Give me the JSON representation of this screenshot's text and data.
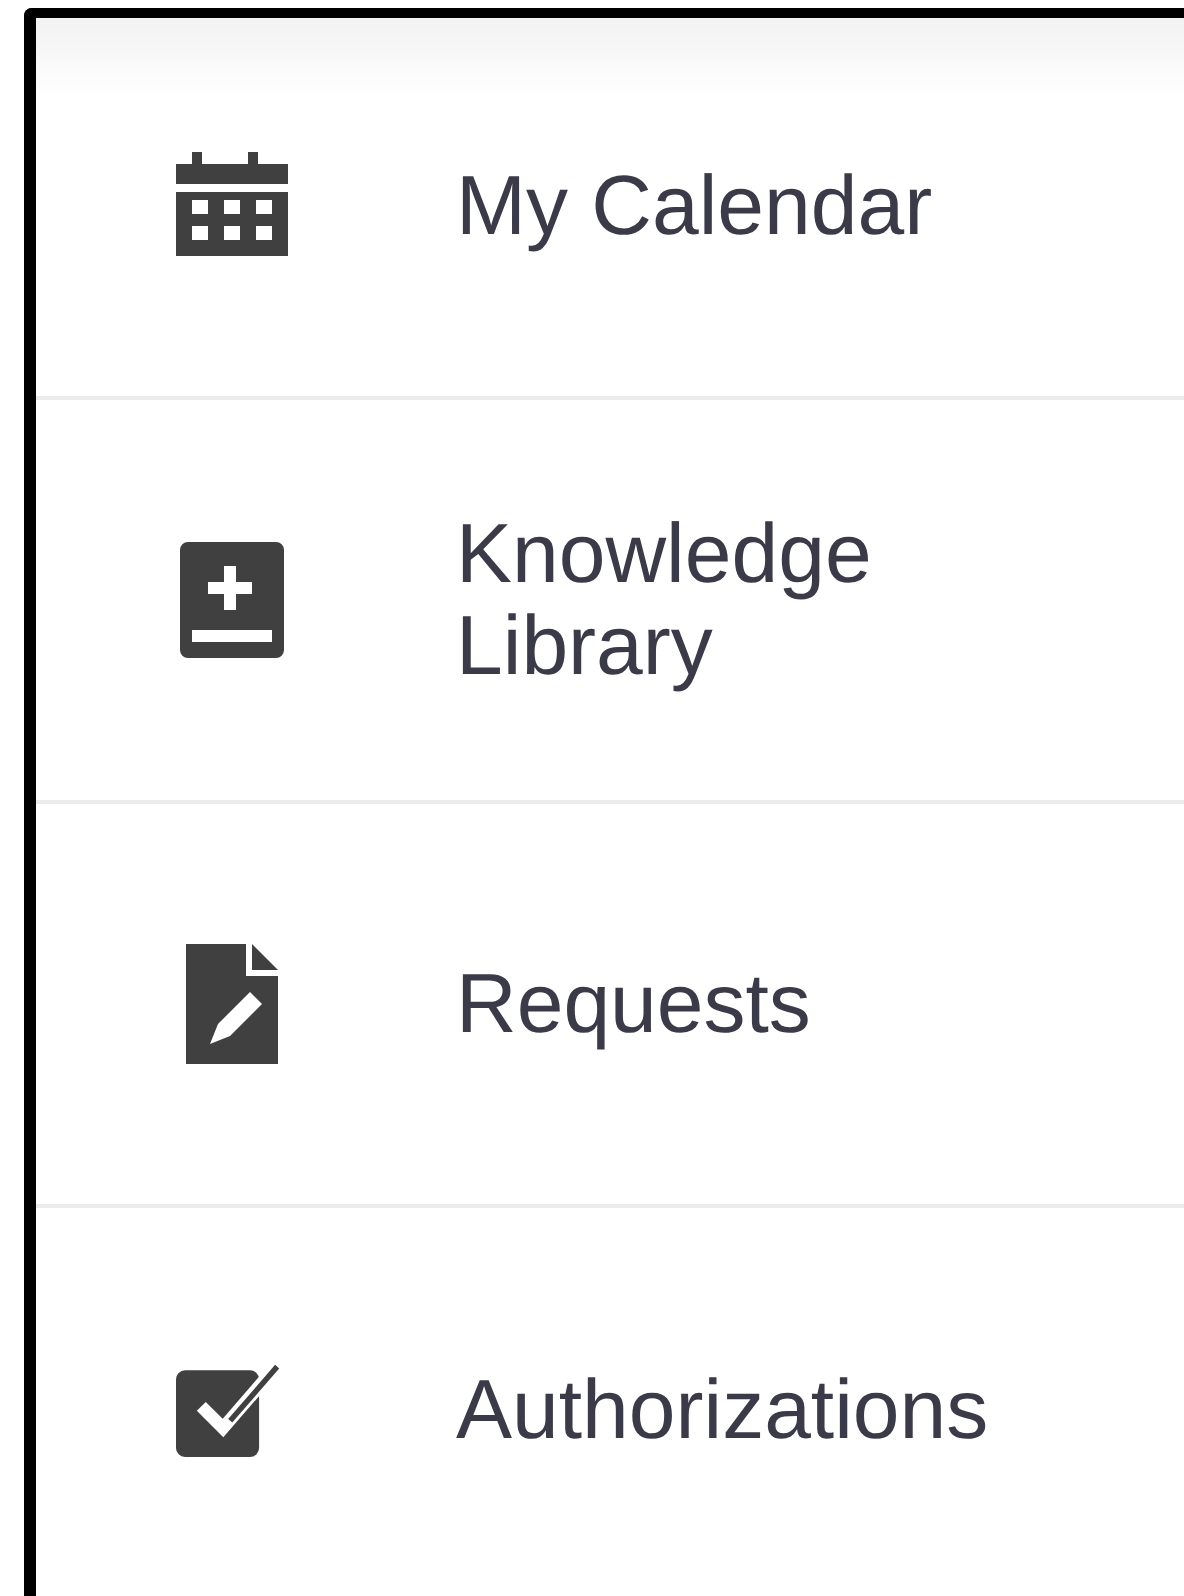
{
  "menu": {
    "items": [
      {
        "label": "My Calendar"
      },
      {
        "label": "Knowledge Library"
      },
      {
        "label": "Requests"
      },
      {
        "label": "Authorizations"
      }
    ]
  }
}
